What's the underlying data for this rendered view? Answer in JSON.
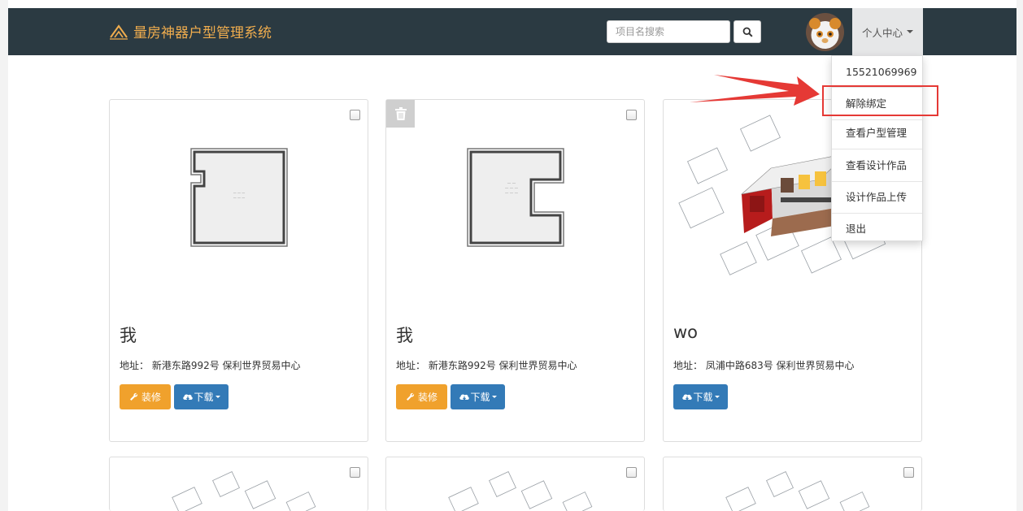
{
  "header": {
    "brand": "量房神器户型管理系统",
    "search_placeholder": "项目名搜索",
    "user_menu_label": "个人中心"
  },
  "dropdown": {
    "items": [
      "15521069969",
      "解除绑定",
      "查看户型管理",
      "查看设计作品",
      "设计作品上传",
      "退出"
    ],
    "highlighted": "解除绑定"
  },
  "cards": [
    {
      "title": "我",
      "address": "地址：  新港东路992号 保利世界贸易中心",
      "decorate_label": "装修",
      "download_label": "下载"
    },
    {
      "title": "我",
      "address": "地址：  新港东路992号 保利世界贸易中心",
      "decorate_label": "装修",
      "download_label": "下载"
    },
    {
      "title": "wo",
      "address": "地址：  凤浦中路683号 保利世界贸易中心",
      "download_label": "下载"
    }
  ],
  "colors": {
    "navbar": "#2b3a42",
    "brand": "#f0ad4e",
    "orange_button": "#f0a12c",
    "blue_button": "#337ab7",
    "annotation": "#e53935"
  },
  "icons": [
    "logo-icon",
    "search-icon",
    "avatar-icon",
    "trash-icon",
    "wrench-icon",
    "cloud-download-icon",
    "checkbox-icon",
    "annotation-arrow-icon"
  ]
}
